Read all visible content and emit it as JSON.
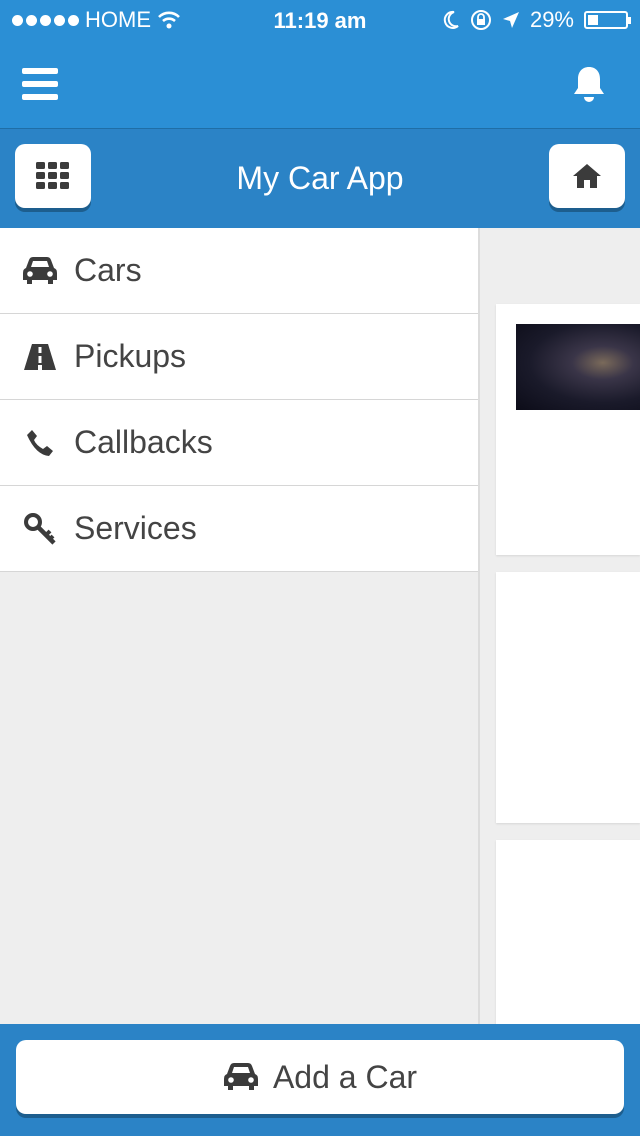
{
  "status_bar": {
    "carrier": "HOME",
    "time": "11:19 am",
    "battery": "29%",
    "battery_level": 0.29
  },
  "header": {
    "title": "My Car App",
    "left_icon": "grid-icon",
    "right_icon": "home-icon"
  },
  "top_bar": {
    "left_icon": "hamburger-menu-icon",
    "right_icon": "bell-icon"
  },
  "menu": {
    "items": [
      {
        "label": "Cars",
        "icon": "car-icon"
      },
      {
        "label": "Pickups",
        "icon": "road-icon"
      },
      {
        "label": "Callbacks",
        "icon": "phone-icon"
      },
      {
        "label": "Services",
        "icon": "key-icon"
      }
    ]
  },
  "footer": {
    "add_button_label": "Add a Car",
    "add_button_icon": "car-icon"
  },
  "colors": {
    "primary": "#2b8fd5",
    "header": "#2b83c6",
    "text": "#444444"
  }
}
